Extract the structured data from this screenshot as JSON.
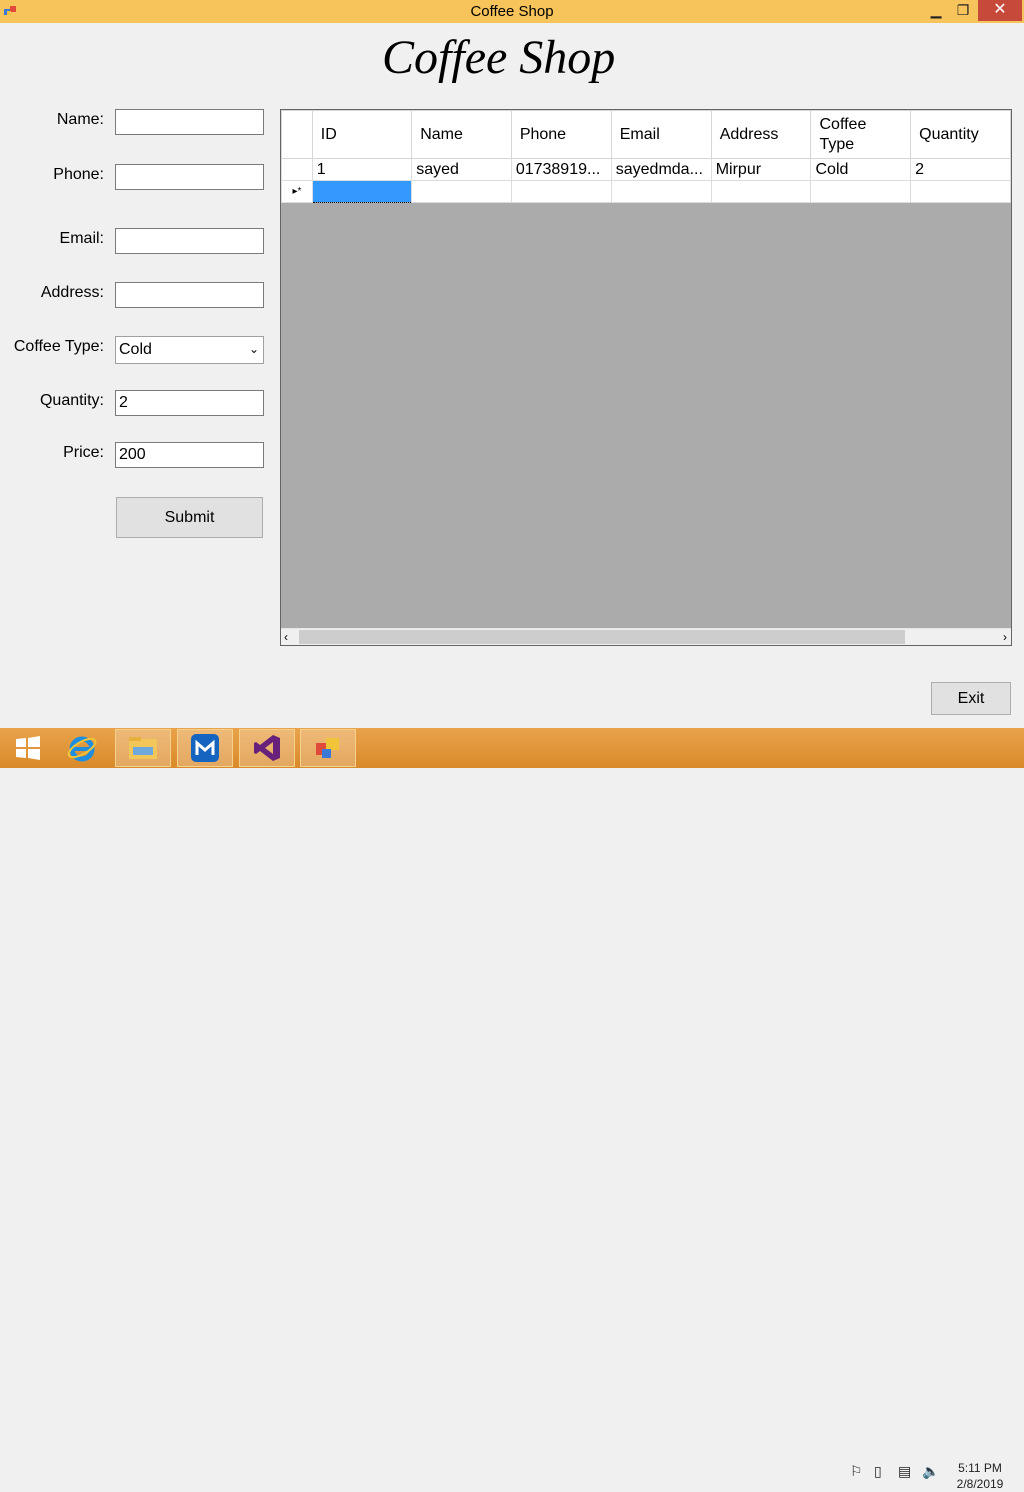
{
  "window": {
    "title": "Coffee Shop"
  },
  "heading": "Coffee Shop",
  "form": {
    "name_label": "Name:",
    "phone_label": "Phone:",
    "email_label": "Email:",
    "address_label": "Address:",
    "coffee_type_label": "Coffee Type:",
    "coffee_type_value": "Cold",
    "quantity_label": "Quantity:",
    "quantity_value": "2",
    "price_label": "Price:",
    "price_value": "200",
    "submit_label": "Submit"
  },
  "grid": {
    "columns": [
      "ID",
      "Name",
      "Phone",
      "Email",
      "Address",
      "Coffee Type",
      "Quantity"
    ],
    "rows": [
      [
        "1",
        "sayed",
        "01738919...",
        "sayedmda...",
        "Mirpur",
        "Cold",
        "2"
      ]
    ],
    "new_row_marker": "▸*"
  },
  "exit_label": "Exit",
  "taskbar": {
    "items": [
      "windows-start",
      "internet-explorer",
      "file-explorer",
      "maxthon-browser",
      "visual-studio",
      "coffee-shop-app"
    ]
  },
  "clock": {
    "time": "5:11 PM",
    "date": "2/8/2019"
  }
}
